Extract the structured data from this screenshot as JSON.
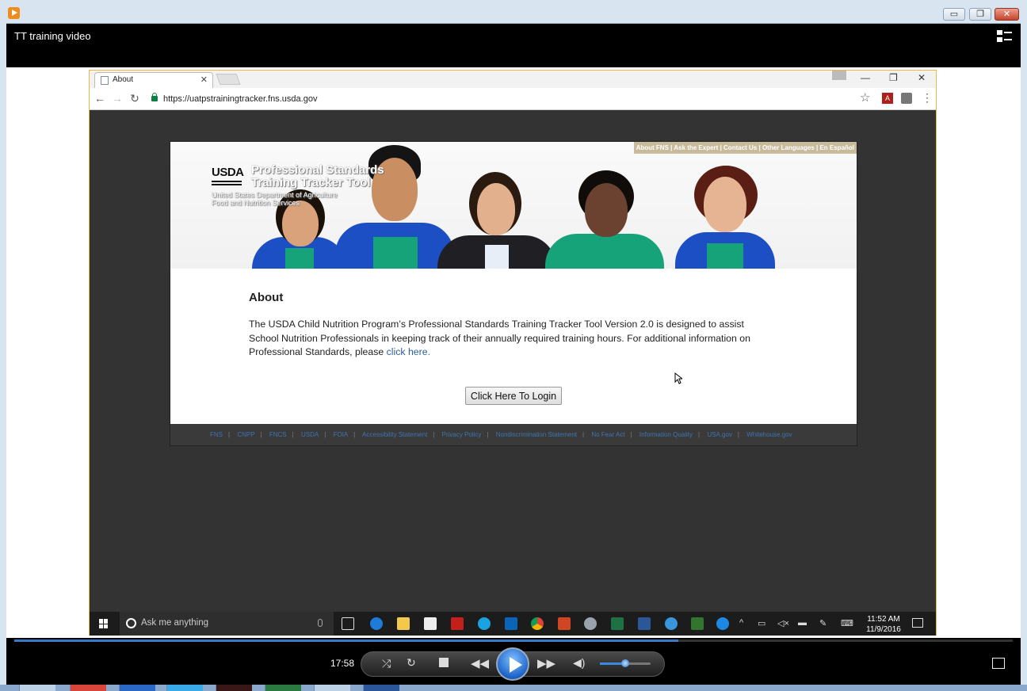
{
  "player": {
    "video_title": "TT training video",
    "time": "17:58",
    "progress_fraction": 0.665,
    "volume_fraction": 0.5,
    "window_buttons": [
      "▭",
      "❐",
      "✕"
    ]
  },
  "browser": {
    "tab_title": "About",
    "tab_close": "✕",
    "url": "https://uatpstrainingtracker.fns.usda.gov",
    "nav": {
      "back": "←",
      "forward": "→",
      "reload": "↻"
    },
    "star": "☆",
    "menu": "⋮",
    "window_controls": {
      "minimize": "—",
      "restore": "❐",
      "close": "✕"
    }
  },
  "page": {
    "top_links": [
      "About FNS",
      "Ask the Expert",
      "Contact Us",
      "Other Languages",
      "En Español"
    ],
    "logo_text": "USDA",
    "banner_title_line1": "Professional Standards",
    "banner_title_line2": "Training Tracker Tool",
    "banner_sub_line1": "United States Department of Agriculture",
    "banner_sub_line2": "Food and Nutrition Services",
    "heading": "About",
    "body_text": "The USDA Child Nutrition Program’s Professional Standards Training Tracker Tool Version 2.0 is designed to assist School Nutrition Professionals in keeping track of their annually required training hours. For additional information on Professional Standards, please ",
    "link_text": "click here.",
    "login_button": "Click Here To Login",
    "footer_links": [
      "FNS",
      "CNPP",
      "FNCS",
      "USDA",
      "FOIA",
      "Accessibility Statement",
      "Privacy Policy",
      "Nondiscrimination Statement",
      "No Fear Act",
      "Information Quality",
      "USA.gov",
      "Whitehouse.gov"
    ]
  },
  "taskbar": {
    "search_placeholder": "Ask me anything",
    "time": "11:52 AM",
    "date": "11/9/2016"
  },
  "colors": {
    "accent_blue": "#3b79c7",
    "link_blue": "#2a5f9e",
    "top_links_bg": "#c7bb9b",
    "uniform_blue": "#1d4fc4",
    "uniform_green": "#17a37a"
  }
}
